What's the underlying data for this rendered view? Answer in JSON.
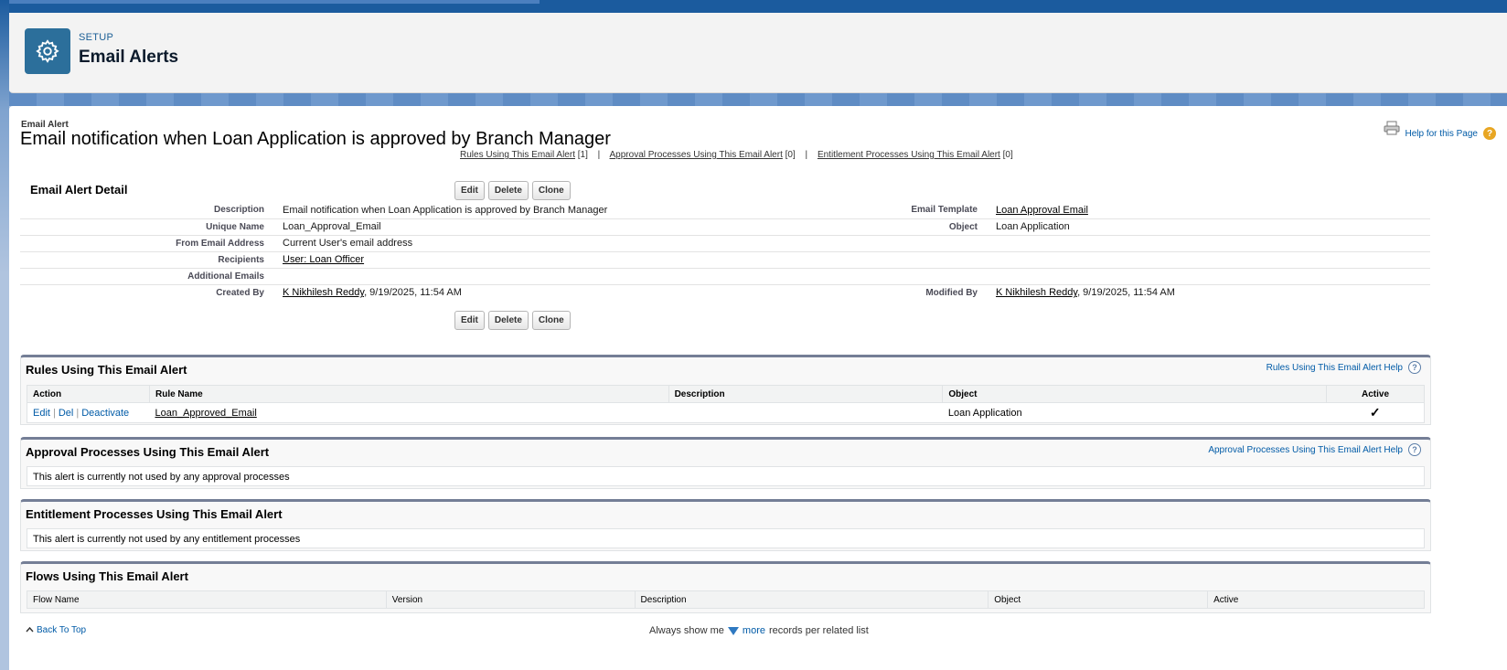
{
  "header": {
    "eyebrow": "SETUP",
    "title": "Email Alerts"
  },
  "page": {
    "type_label": "Email Alert",
    "title": "Email notification when Loan Application is approved by Branch Manager",
    "help_label": "Help for this Page",
    "help_badge": "?"
  },
  "quicklinks": [
    {
      "label": "Rules Using This Email Alert",
      "count": "[1]"
    },
    {
      "label": "Approval Processes Using This Email Alert",
      "count": "[0]"
    },
    {
      "label": "Entitlement Processes Using This Email Alert",
      "count": "[0]"
    }
  ],
  "quicklink_sep": "|",
  "detail": {
    "title": "Email Alert Detail",
    "buttons": {
      "edit": "Edit",
      "delete": "Delete",
      "clone": "Clone"
    },
    "rows": {
      "description_label": "Description",
      "description_value": "Email notification when Loan Application is approved by Branch Manager",
      "template_label": "Email Template",
      "template_value": "Loan Approval Email",
      "unique_label": "Unique Name",
      "unique_value": "Loan_Approval_Email",
      "object_label": "Object",
      "object_value": "Loan Application",
      "from_label": "From Email Address",
      "from_value": "Current User's email address",
      "recipients_label": "Recipients",
      "recipients_value": "User: Loan Officer",
      "additional_label": "Additional Emails",
      "created_label": "Created By",
      "created_user": "K Nikhilesh Reddy",
      "created_date": ", 9/19/2025, 11:54 AM",
      "modified_label": "Modified By",
      "modified_user": "K Nikhilesh Reddy",
      "modified_date": ", 9/19/2025, 11:54 AM"
    }
  },
  "rules": {
    "title": "Rules Using This Email Alert",
    "help": "Rules Using This Email Alert Help",
    "columns": {
      "action": "Action",
      "rule_name": "Rule Name",
      "description": "Description",
      "object": "Object",
      "active": "Active"
    },
    "row": {
      "edit": "Edit",
      "del": "Del",
      "deactivate": "Deactivate",
      "pipe": "|",
      "rule_name": "Loan_Approved_Email",
      "description": "",
      "object": "Loan Application",
      "active": "✓"
    }
  },
  "approval": {
    "title": "Approval Processes Using This Email Alert",
    "help": "Approval Processes Using This Email Alert Help",
    "empty": "This alert is currently not used by any approval processes"
  },
  "entitlement": {
    "title": "Entitlement Processes Using This Email Alert",
    "empty": "This alert is currently not used by any entitlement processes"
  },
  "flows": {
    "title": "Flows Using This Email Alert",
    "columns": {
      "flow_name": "Flow Name",
      "version": "Version",
      "description": "Description",
      "object": "Object",
      "active": "Active"
    }
  },
  "footer": {
    "back_to_top": "Back To Top",
    "always_show": "Always show me",
    "more": "more",
    "per_list": "records per related list"
  }
}
